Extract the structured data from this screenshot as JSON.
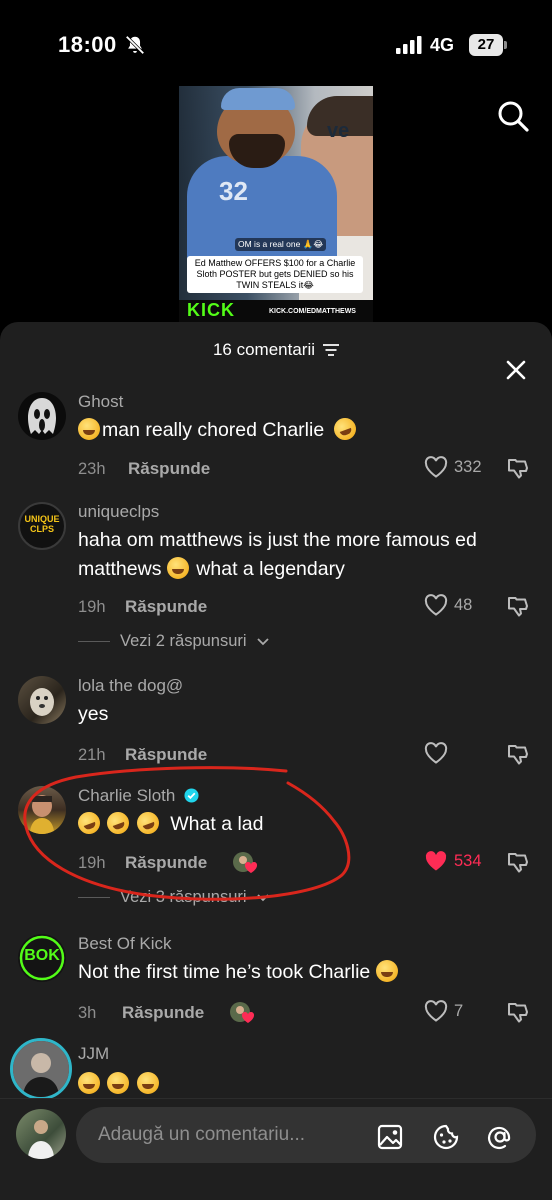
{
  "status_bar": {
    "time": "18:00",
    "network": "4G",
    "battery": "27"
  },
  "video": {
    "overlay_small": "OM is a real one 🙏😂",
    "caption": "Ed Matthew OFFERS $100 for a Charlie Sloth POSTER but gets DENIED so his TWIN STEALS it😂",
    "brand": "KICK",
    "url": "KICK.COM/EDMATTHEWS",
    "jersey_number": "32",
    "sign_text": "ve"
  },
  "sheet": {
    "title": "16 comentarii"
  },
  "comments": [
    {
      "name": "Ghost",
      "text": "man really chored Charlie",
      "time": "23h",
      "reply": "Răspunde",
      "likes": "332"
    },
    {
      "name": "uniqueclps",
      "text_a": "haha om matthews is just the more famous ed matthews",
      "text_b": "what a legendary",
      "time": "19h",
      "reply": "Răspunde",
      "likes": "48",
      "view_replies": "Vezi 2 răspunsuri",
      "avatar_text": "UNIQUE CLPS"
    },
    {
      "name": "lola the dog@",
      "text": "yes",
      "time": "21h",
      "reply": "Răspunde",
      "likes": ""
    },
    {
      "name": "Charlie Sloth",
      "text": "What a lad",
      "time": "19h",
      "reply": "Răspunde",
      "likes": "534",
      "view_replies": "Vezi 3 răspunsuri"
    },
    {
      "name": "Best Of Kick",
      "text": "Not the first time he’s took Charlie",
      "time": "3h",
      "reply": "Răspunde",
      "likes": "7",
      "avatar_text": "BOK"
    },
    {
      "name": "JJM",
      "text": ""
    }
  ],
  "input": {
    "placeholder": "Adaugă un comentariu..."
  },
  "colors": {
    "sheet_bg": "#1f1f1f",
    "like_active": "#fe2c55",
    "annotation": "#d9261c",
    "kick_green": "#53fc18",
    "verified": "#20d5ec"
  }
}
